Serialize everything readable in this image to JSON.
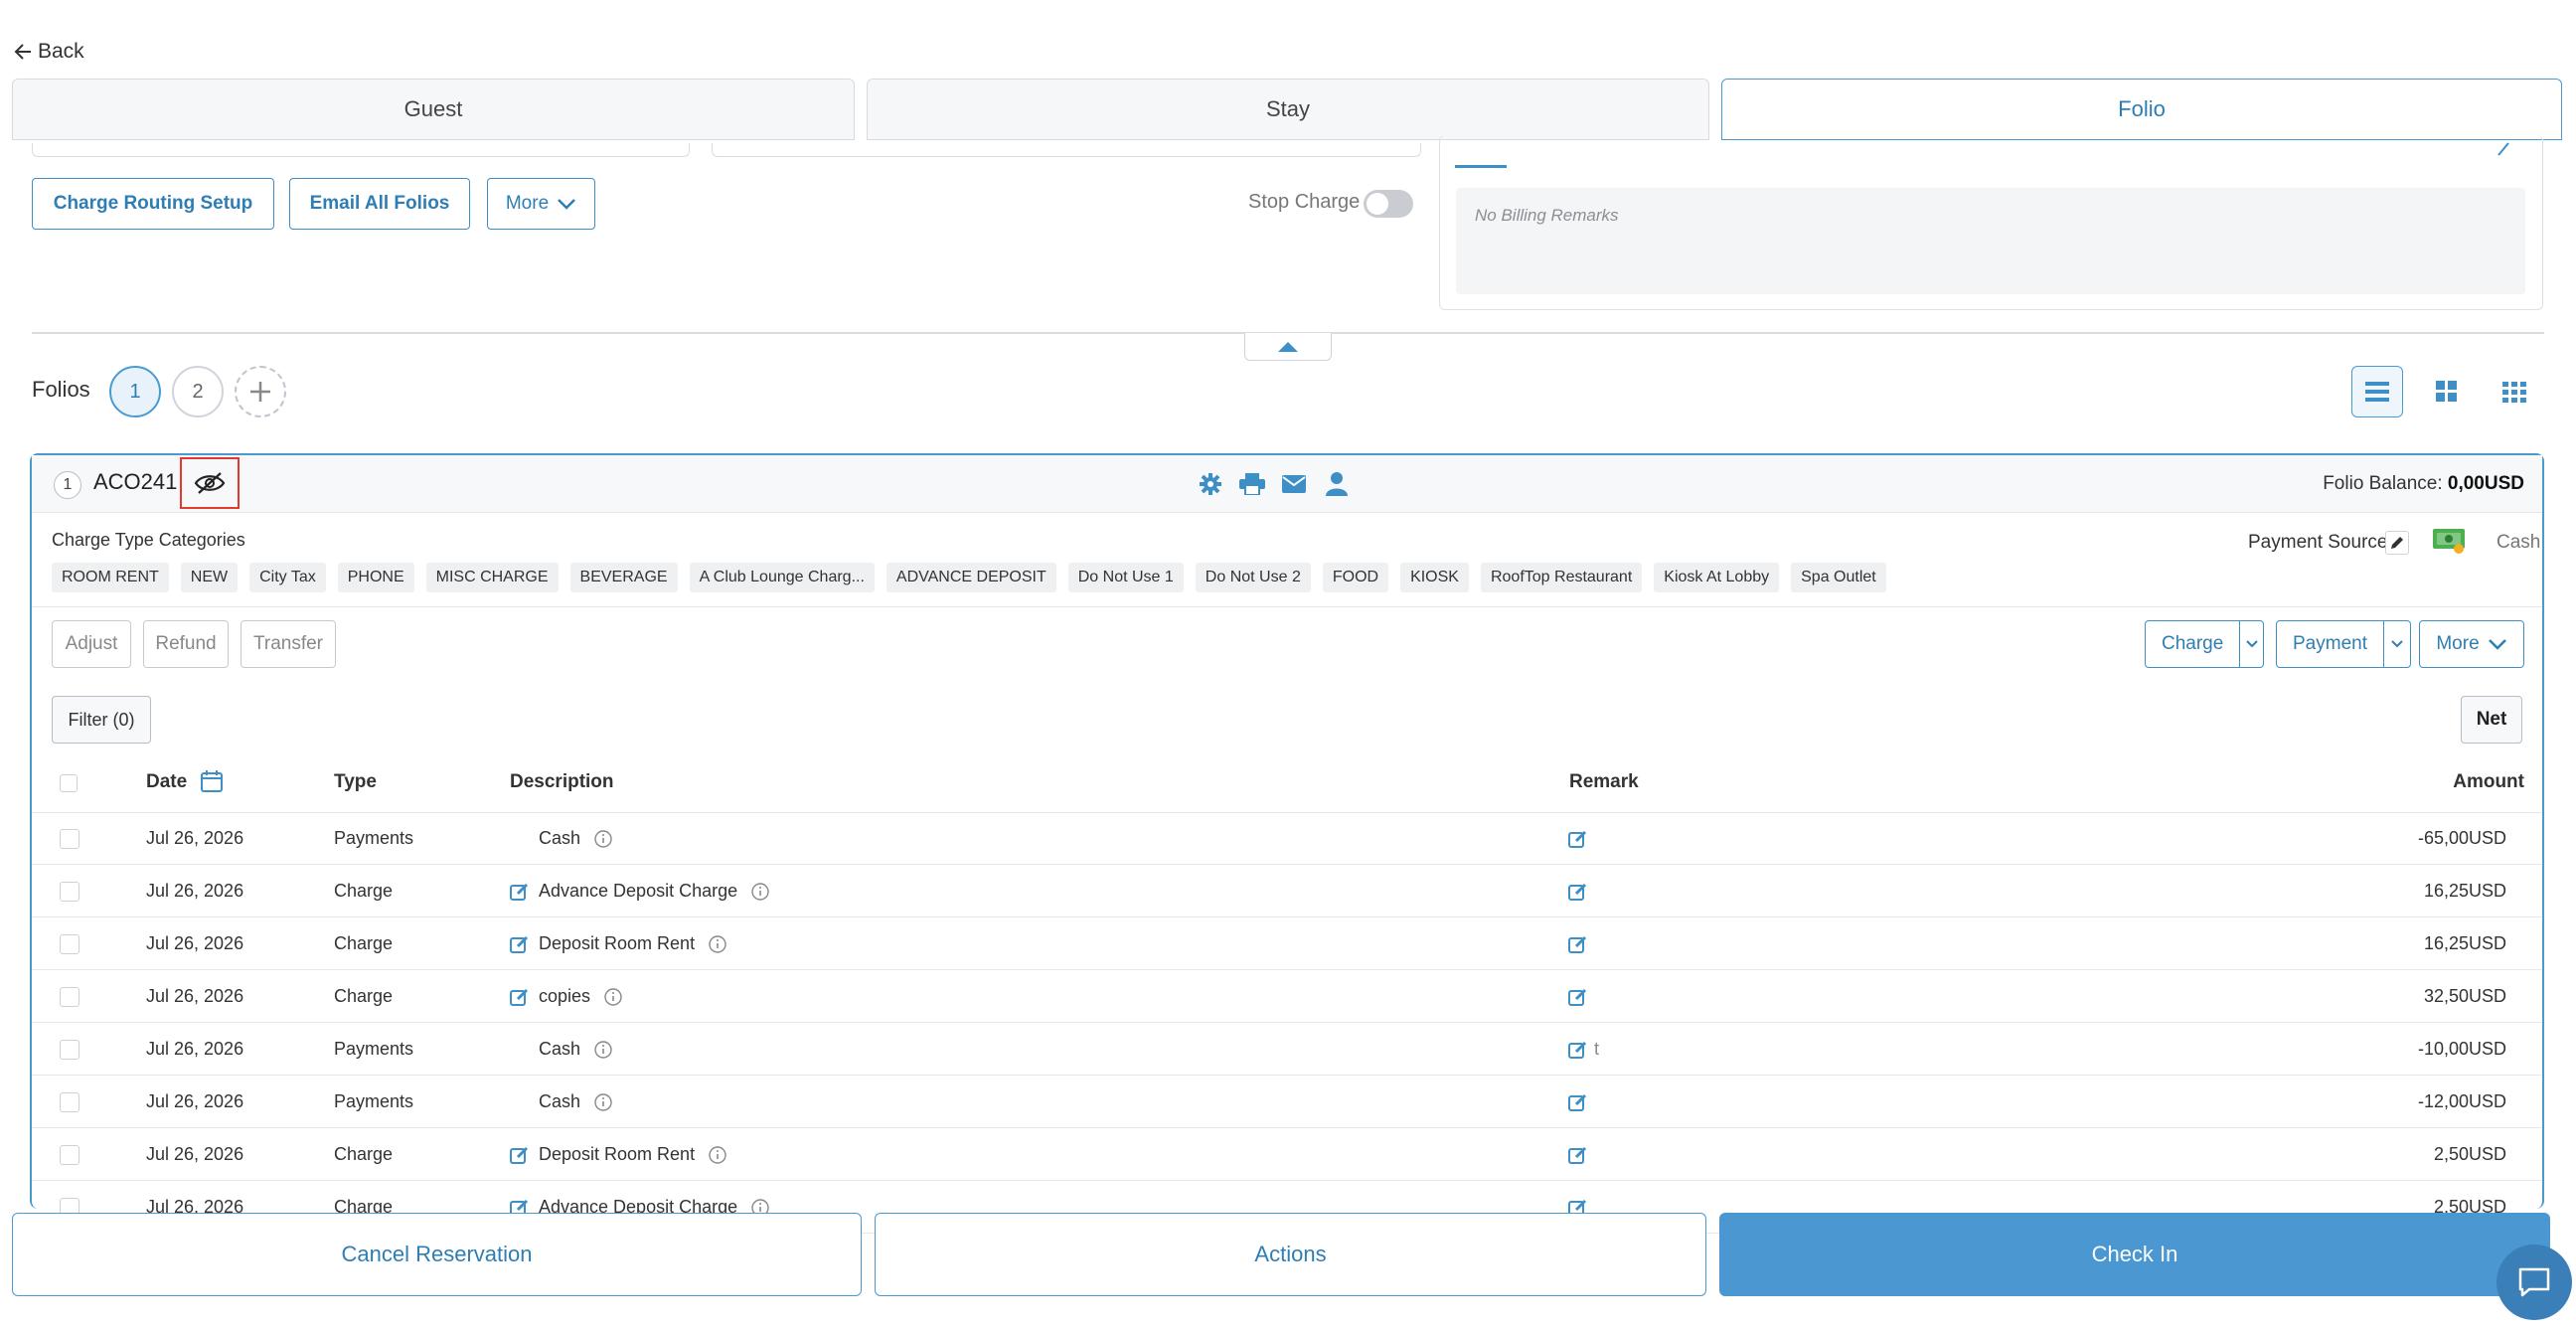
{
  "nav": {
    "back_label": "Back"
  },
  "tabs": [
    {
      "label": "Guest",
      "active": false
    },
    {
      "label": "Stay",
      "active": false
    },
    {
      "label": "Folio",
      "active": true
    }
  ],
  "toolbar": {
    "charge_routing_label": "Charge Routing Setup",
    "email_all_label": "Email All Folios",
    "more_label": "More",
    "stop_charge_label": "Stop Charge"
  },
  "billing": {
    "remarks_text": "No Billing Remarks"
  },
  "folios": {
    "label": "Folios",
    "items": [
      "1",
      "2"
    ],
    "active": "1"
  },
  "folio": {
    "number": "1",
    "code": "ACO241",
    "balance_label": "Folio Balance:",
    "balance_value": "0,00USD",
    "charge_type_label": "Charge Type Categories",
    "categories": [
      "ROOM RENT",
      "NEW",
      "City Tax",
      "PHONE",
      "MISC CHARGE",
      "BEVERAGE",
      "A Club Lounge Charg...",
      "ADVANCE DEPOSIT",
      "Do Not Use 1",
      "Do Not Use 2",
      "FOOD",
      "KIOSK",
      "RoofTop Restaurant",
      "Kiosk At Lobby",
      "Spa Outlet"
    ],
    "payment_source_label": "Payment Source",
    "payment_source_value": "Cash",
    "actions": {
      "adjust": "Adjust",
      "refund": "Refund",
      "transfer": "Transfer",
      "charge": "Charge",
      "payment": "Payment",
      "more": "More"
    },
    "filter_label": "Filter (0)",
    "net_label": "Net"
  },
  "table": {
    "headers": {
      "date": "Date",
      "type": "Type",
      "description": "Description",
      "remark": "Remark",
      "amount": "Amount"
    },
    "rows": [
      {
        "date": "Jul 26, 2026",
        "type": "Payments",
        "description": "Cash",
        "editable": false,
        "remark": "",
        "amount": "-65,00USD"
      },
      {
        "date": "Jul 26, 2026",
        "type": "Charge",
        "description": "Advance Deposit Charge",
        "editable": true,
        "remark": "",
        "amount": "16,25USD"
      },
      {
        "date": "Jul 26, 2026",
        "type": "Charge",
        "description": "Deposit Room Rent",
        "editable": true,
        "remark": "",
        "amount": "16,25USD"
      },
      {
        "date": "Jul 26, 2026",
        "type": "Charge",
        "description": "copies",
        "editable": true,
        "remark": "",
        "amount": "32,50USD"
      },
      {
        "date": "Jul 26, 2026",
        "type": "Payments",
        "description": "Cash",
        "editable": false,
        "remark": "t",
        "amount": "-10,00USD"
      },
      {
        "date": "Jul 26, 2026",
        "type": "Payments",
        "description": "Cash",
        "editable": false,
        "remark": "",
        "amount": "-12,00USD"
      },
      {
        "date": "Jul 26, 2026",
        "type": "Charge",
        "description": "Deposit Room Rent",
        "editable": true,
        "remark": "",
        "amount": "2,50USD"
      },
      {
        "date": "Jul 26, 2026",
        "type": "Charge",
        "description": "Advance Deposit Charge",
        "editable": true,
        "remark": "",
        "amount": "2,50USD"
      }
    ]
  },
  "footer": {
    "cancel_label": "Cancel Reservation",
    "actions_label": "Actions",
    "checkin_label": "Check In"
  },
  "colors": {
    "accent": "#3d8fc6",
    "primary_button": "#4a97d2",
    "highlight": "#e23a2e"
  }
}
